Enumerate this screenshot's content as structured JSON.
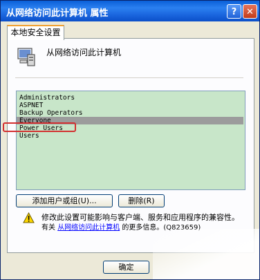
{
  "window": {
    "title": "从网络访问此计算机 属性",
    "help_button": "?",
    "close_button": "✕"
  },
  "tab": {
    "label": "本地安全设置"
  },
  "policy": {
    "heading": "从网络访问此计算机"
  },
  "accounts": {
    "items": [
      "Administrators",
      "ASPNET",
      "Backup Operators",
      "Everyone",
      "Power Users",
      "Users"
    ],
    "selected": "Everyone",
    "highlighted": "Power Users"
  },
  "buttons": {
    "add": "添加用户或组(U)...",
    "remove": "删除(R)",
    "ok": "确定"
  },
  "warning": {
    "line1": "修改此设置可能影响与客户端、服务和应用程序的兼容性。",
    "prefix": "有关",
    "link": "从网络访问此计算机",
    "suffix": "的更多信息。(Q823659)"
  }
}
